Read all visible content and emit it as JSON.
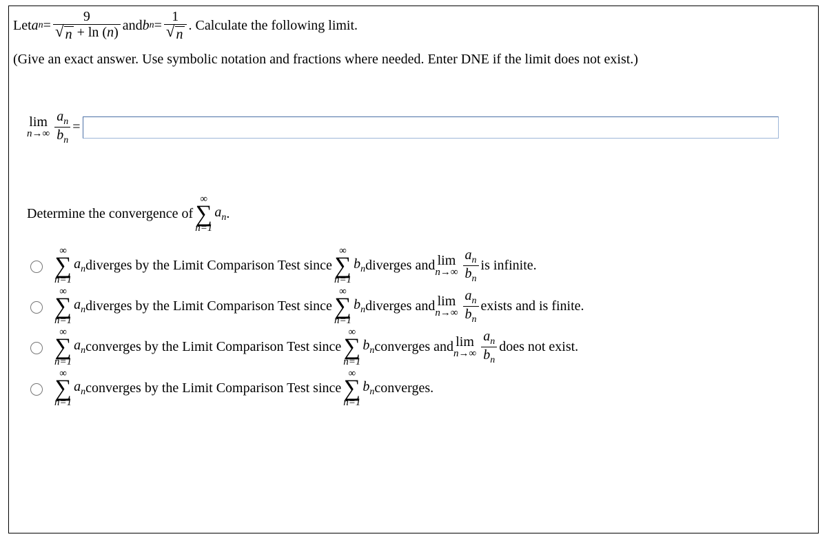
{
  "intro": {
    "let": "Let ",
    "a_sym": "a",
    "b_sym": "b",
    "n_sym": "n",
    "eq": " = ",
    "and": " and ",
    "calc": ". Calculate the following limit.",
    "a_num": "9",
    "a_den_sqrt": "n",
    "a_den_plus": " + ln (",
    "a_den_close": ")",
    "b_num": "1",
    "b_den_sqrt": "n"
  },
  "hint": "(Give an exact answer. Use symbolic notation and fractions where needed. Enter DNE if the limit does not exist.)",
  "limit": {
    "lim": "lim",
    "sub": "n→∞",
    "frac_top_a": "a",
    "frac_top_n": "n",
    "frac_bot_b": "b",
    "frac_bot_n": "n",
    "eq": " = ",
    "value": ""
  },
  "determine": {
    "text": "Determine the convergence of ",
    "inf": "∞",
    "from": "n=1",
    "term_a": "a",
    "term_n": "n",
    "dot": "."
  },
  "sum": {
    "inf": "∞",
    "from": "n=1"
  },
  "opts": {
    "o1": {
      "t1": " diverges by the Limit Comparison Test since ",
      "t2": " diverges and ",
      "t3": " is infinite."
    },
    "o2": {
      "t1": " diverges by the Limit Comparison Test since ",
      "t2": " diverges and ",
      "t3": " exists and is finite."
    },
    "o3": {
      "t1": " converges by the Limit Comparison Test since ",
      "t2": " converges and ",
      "t3": " does not exist."
    },
    "o4": {
      "t1": " converges by the Limit Comparison Test since ",
      "t2": " converges."
    }
  },
  "sym": {
    "a": "a",
    "b": "b",
    "n": "n",
    "lim": "lim",
    "ntoinf": "n→∞"
  }
}
